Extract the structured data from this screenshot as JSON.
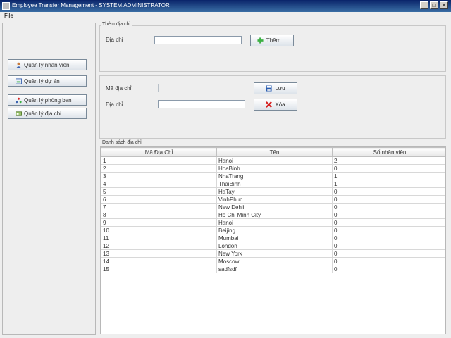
{
  "window": {
    "title": "Employee Transfer Management - SYSTEM.ADMINISTRATOR",
    "minimize": "_",
    "maximize": "□",
    "close": "×"
  },
  "menu": {
    "file": "File"
  },
  "sidebar": {
    "items": [
      {
        "label": "Quản lý nhân viên",
        "icon": "user-icon"
      },
      {
        "label": "Quản lý dự án",
        "icon": "project-icon"
      },
      {
        "label": "Quản lý phòng ban",
        "icon": "department-icon"
      },
      {
        "label": "Quản lý địa chỉ",
        "icon": "address-icon"
      }
    ]
  },
  "add_panel": {
    "legend": "Thêm địa chỉ",
    "address_label": "Địa chỉ",
    "address_value": "",
    "add_button": "Thêm ..."
  },
  "edit_panel": {
    "code_label": "Mã địa chỉ",
    "code_value": "",
    "address_label": "Địa chỉ",
    "address_value": "",
    "save_button": "Lưu",
    "delete_button": "Xóa"
  },
  "list_panel": {
    "legend": "Danh sách địa chỉ",
    "columns": [
      "Mã Địa Chỉ",
      "Tên",
      "Số nhân viên"
    ],
    "rows": [
      [
        "1",
        "Hanoi",
        "2"
      ],
      [
        "2",
        "HoaBinh",
        "0"
      ],
      [
        "3",
        "NhaTrang",
        "1"
      ],
      [
        "4",
        "ThaiBinh",
        "1"
      ],
      [
        "5",
        "HaTay",
        "0"
      ],
      [
        "6",
        "VinhPhuc",
        "0"
      ],
      [
        "7",
        "New Dehli",
        "0"
      ],
      [
        "8",
        "Ho Chi Minh City",
        "0"
      ],
      [
        "9",
        "Hanoi",
        "0"
      ],
      [
        "10",
        "Beijing",
        "0"
      ],
      [
        "11",
        "Mumbai",
        "0"
      ],
      [
        "12",
        "London",
        "0"
      ],
      [
        "13",
        "New York",
        "0"
      ],
      [
        "14",
        "Moscow",
        "0"
      ],
      [
        "15",
        "sadfsdf",
        "0"
      ]
    ]
  },
  "colors": {
    "title_bar": "#0a246a",
    "add_icon": "#3cb043",
    "delete_icon": "#d62020",
    "save_icon": "#2a5db0"
  }
}
